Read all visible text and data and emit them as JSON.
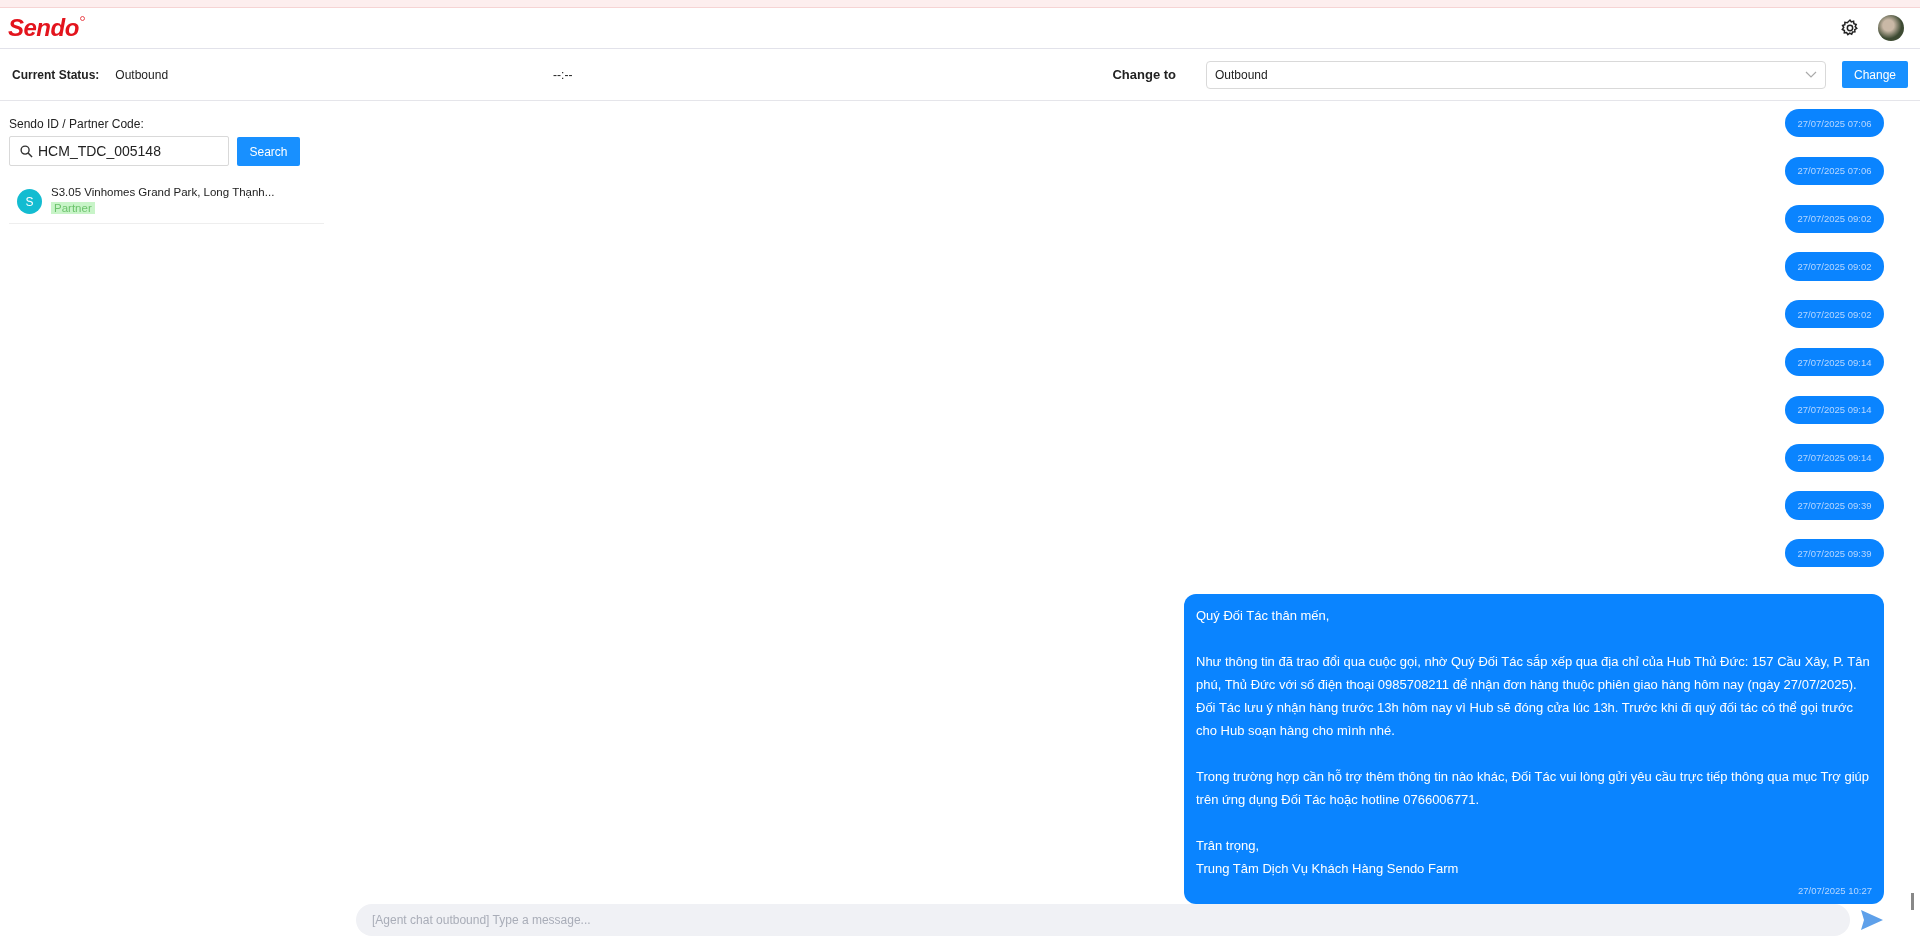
{
  "header": {
    "logo": "Sendo"
  },
  "status_bar": {
    "current_status_label": "Current Status:",
    "current_status": "Outbound",
    "timer": "--:--",
    "change_to_label": "Change to",
    "change_to_value": "Outbound",
    "change_button": "Change"
  },
  "search": {
    "label": "Sendo ID / Partner Code:",
    "value": "HCM_TDC_005148",
    "button": "Search"
  },
  "results": [
    {
      "avatar": "S",
      "title": "S3.05 Vinhomes Grand Park, Long Thạnh...",
      "tag": "Partner"
    }
  ],
  "messages": [
    {
      "kind": "empty",
      "time": "27/07/2025 07:06"
    },
    {
      "kind": "empty",
      "time": "27/07/2025 07:06"
    },
    {
      "kind": "empty",
      "time": "27/07/2025 09:02"
    },
    {
      "kind": "empty",
      "time": "27/07/2025 09:02"
    },
    {
      "kind": "empty",
      "time": "27/07/2025 09:02"
    },
    {
      "kind": "empty",
      "time": "27/07/2025 09:14"
    },
    {
      "kind": "empty",
      "time": "27/07/2025 09:14"
    },
    {
      "kind": "empty",
      "time": "27/07/2025 09:14"
    },
    {
      "kind": "empty",
      "time": "27/07/2025 09:39"
    },
    {
      "kind": "empty",
      "time": "27/07/2025 09:39"
    },
    {
      "kind": "text",
      "text": "Quý Đối Tác thân mến,\n\nNhư thông tin đã trao đổi qua cuộc gọi, nhờ Quý Đối Tác sắp xếp qua địa chỉ của Hub Thủ Đức: 157 Cầu Xây, P. Tân phú, Thủ Đức với số điện thoại 0985708211 để nhận đơn hàng thuộc phiên giao hàng hôm nay (ngày 27/07/2025). Đối Tác lưu ý nhận hàng trước 13h hôm nay vì Hub sẽ đóng cửa lúc 13h. Trước khi đi quý đối tác có thể gọi trước cho Hub soạn hàng cho mình nhé.\n\nTrong trường hợp cần hỗ trợ thêm thông tin nào khác, Đối Tác vui lòng gửi yêu cầu trực tiếp thông qua mục Trợ giúp trên ứng dụng Đối Tác hoặc hotline 0766006771.\n\nTrân trọng,\nTrung Tâm Dịch Vụ Khách Hàng Sendo Farm",
      "time": "27/07/2025 10:27"
    }
  ],
  "composer": {
    "placeholder": "[Agent chat outbound] Type a message..."
  }
}
